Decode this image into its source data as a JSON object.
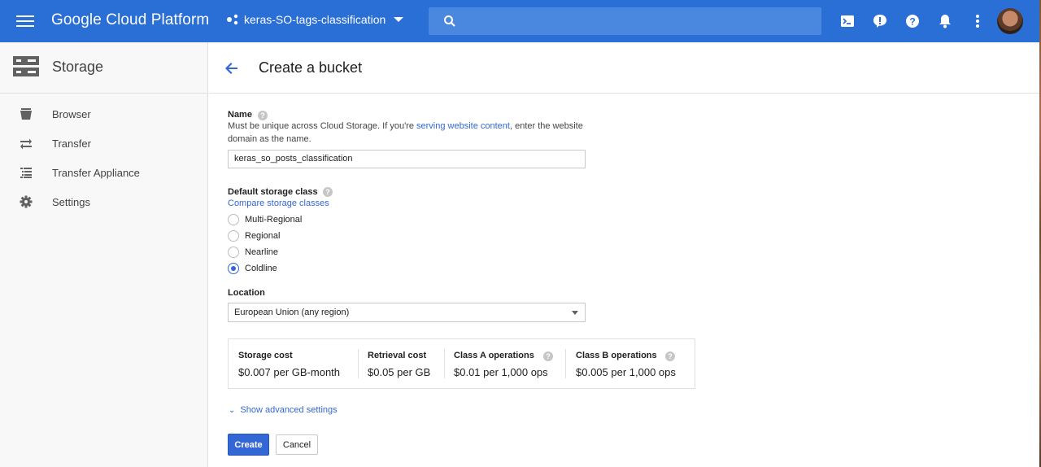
{
  "topbar": {
    "brand": "Google Cloud Platform",
    "project": "keras-SO-tags-classification",
    "search_placeholder": "",
    "icons": [
      "menu-icon",
      "search-icon",
      "cloud-shell-icon",
      "alert-icon",
      "help-icon",
      "notifications-icon",
      "more-vert-icon"
    ]
  },
  "sidebar": {
    "title": "Storage",
    "items": [
      {
        "label": "Browser",
        "icon": "bucket-icon"
      },
      {
        "label": "Transfer",
        "icon": "transfer-icon"
      },
      {
        "label": "Transfer Appliance",
        "icon": "list-icon"
      },
      {
        "label": "Settings",
        "icon": "gear-icon"
      }
    ]
  },
  "page": {
    "title": "Create a bucket"
  },
  "name_section": {
    "label": "Name",
    "hint_before": "Must be unique across Cloud Storage. If you're ",
    "hint_link": "serving website content",
    "hint_after": ", enter the website domain as the name.",
    "value": "keras_so_posts_classification"
  },
  "storage_class": {
    "label": "Default storage class",
    "compare_link": "Compare storage classes",
    "options": [
      {
        "label": "Multi-Regional",
        "selected": false
      },
      {
        "label": "Regional",
        "selected": false
      },
      {
        "label": "Nearline",
        "selected": false
      },
      {
        "label": "Coldline",
        "selected": true
      }
    ]
  },
  "location": {
    "label": "Location",
    "value": "European Union (any region)"
  },
  "costs": [
    {
      "header": "Storage cost",
      "value": "$0.007 per GB-month",
      "help": false
    },
    {
      "header": "Retrieval cost",
      "value": "$0.05 per GB",
      "help": false
    },
    {
      "header": "Class A operations",
      "value": "$0.01 per 1,000 ops",
      "help": true
    },
    {
      "header": "Class B operations",
      "value": "$0.005 per 1,000 ops",
      "help": true
    }
  ],
  "advanced_link": "Show advanced settings",
  "buttons": {
    "create": "Create",
    "cancel": "Cancel"
  },
  "colors": {
    "topbar": "#2a6fd6",
    "accent": "#3367d6",
    "sidebar_bg": "#f8f8f8"
  }
}
